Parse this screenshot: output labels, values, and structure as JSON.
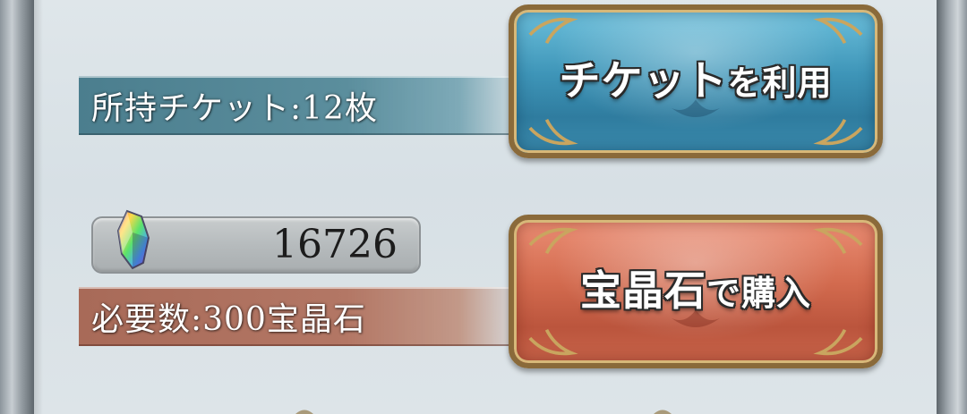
{
  "tickets": {
    "label": "所持チケット:12枚"
  },
  "crystals": {
    "icon": "rainbow-crystal-icon",
    "count": "16726"
  },
  "cost": {
    "label": "必要数:300宝晶石"
  },
  "buttons": {
    "use_ticket_main": "チケット",
    "use_ticket_tail": "を利用",
    "buy_crystal_main": "宝晶石",
    "buy_crystal_tail": "で購入"
  },
  "colors": {
    "ticket_button": "#3e95b8",
    "crystal_button": "#d26a4e",
    "ticket_bar": "#4b7e8e",
    "cost_bar": "#a86a58",
    "gold_trim": "#d7b879"
  }
}
